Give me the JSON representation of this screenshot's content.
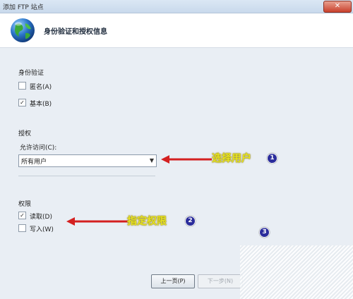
{
  "window": {
    "title": "添加 FTP 站点",
    "close_glyph": "✕"
  },
  "header": {
    "title": "身份验证和授权信息",
    "icon": "globe-icon"
  },
  "auth": {
    "section_label": "身份验证",
    "anonymous_label": "匿名(A)",
    "anonymous_checked": false,
    "basic_label": "基本(B)",
    "basic_checked": true
  },
  "authorization": {
    "section_label": "授权",
    "allow_access_label": "允许访问(C):",
    "selected": "所有用户"
  },
  "permissions": {
    "section_label": "权限",
    "read_label": "读取(D)",
    "read_checked": true,
    "write_label": "写入(W)",
    "write_checked": false
  },
  "annotations": {
    "select_user": "选择用户",
    "badge1": "1",
    "specify_permission": "指定权限",
    "badge2": "2",
    "badge3": "3",
    "arrow_color": "#d42020",
    "text_color": "#e7e321"
  },
  "buttons": {
    "prev": "上一页(P)",
    "next": "下一步(N)"
  },
  "marks": {
    "check": "✓",
    "dropdown_arrow": "▼"
  }
}
